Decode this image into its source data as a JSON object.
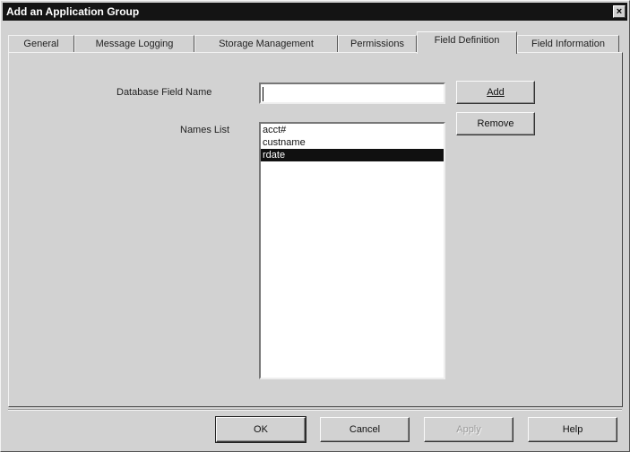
{
  "window": {
    "title": "Add an Application Group",
    "close_glyph": "×"
  },
  "tabs": [
    {
      "label": "General"
    },
    {
      "label": "Message Logging"
    },
    {
      "label": "Storage Management"
    },
    {
      "label": "Permissions"
    },
    {
      "label": "Field Definition",
      "active": true
    },
    {
      "label": "Field Information"
    }
  ],
  "form": {
    "db_field_label": "Database Field Name",
    "db_field_value": "",
    "names_list_label": "Names List",
    "names_list": [
      {
        "label": "acct#",
        "selected": false
      },
      {
        "label": "custname",
        "selected": false
      },
      {
        "label": "rdate",
        "selected": true
      }
    ],
    "add_label": "Add",
    "remove_label": "Remove"
  },
  "footer": {
    "ok_label": "OK",
    "cancel_label": "Cancel",
    "apply_label": "Apply",
    "help_label": "Help"
  }
}
